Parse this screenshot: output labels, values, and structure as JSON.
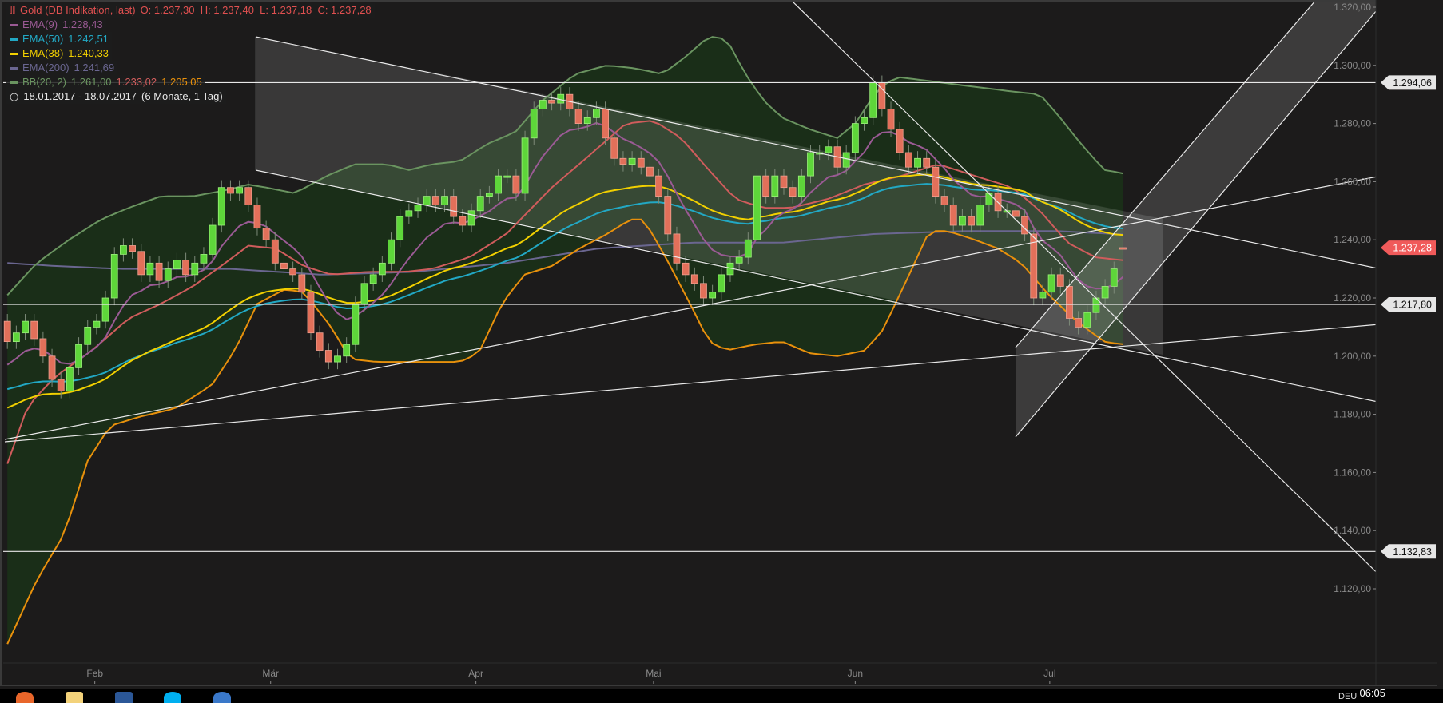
{
  "legend": {
    "title": "Gold (DB Indikation, last)",
    "ohlc": "O: 1.237,30  H: 1.237,40  L: 1.237,18  C: 1.237,28",
    "ema9": {
      "label": "EMA(9)",
      "value": "1.228,43",
      "color": "#9a5a94"
    },
    "ema50": {
      "label": "EMA(50)",
      "value": "1.242,51",
      "color": "#22a8c4"
    },
    "ema38": {
      "label": "EMA(38)",
      "value": "1.240,33",
      "color": "#f2d000"
    },
    "ema200": {
      "label": "EMA(200)",
      "value": "1.241,69",
      "color": "#6a6690"
    },
    "bb": {
      "label": "BB(20, 2)",
      "upper": "1.261,00",
      "mid": "1.233,02",
      "lower": "1.205,05",
      "color_upper": "#6a9460",
      "color_mid": "#d05c5c",
      "color_lower": "#e8900c"
    },
    "range": "18.01.2017 - 18.07.2017",
    "span": "(6 Monate, 1 Tag)"
  },
  "price_tags": [
    {
      "value": 1294.06,
      "label": "1.294,06",
      "color": "#e6e6e6"
    },
    {
      "value": 1237.28,
      "label": "1.237,28",
      "color": "#f05a5a"
    },
    {
      "value": 1217.8,
      "label": "1.217,80",
      "color": "#e6e6e6"
    },
    {
      "value": 1132.83,
      "label": "1.132,83",
      "color": "#e6e6e6"
    }
  ],
  "taskbar": {
    "clock": "06:05",
    "lang": "DEU"
  },
  "chart_data": {
    "type": "candlestick",
    "title": "Gold (DB Indikation, last)",
    "ylim": [
      1100,
      1325
    ],
    "yticks": [
      {
        "v": 1320,
        "l": "1.320,00"
      },
      {
        "v": 1300,
        "l": "1.300,00"
      },
      {
        "v": 1280,
        "l": "1.280,00"
      },
      {
        "v": 1260,
        "l": "1.260,00"
      },
      {
        "v": 1240,
        "l": "1.240,00"
      },
      {
        "v": 1220,
        "l": "1.220,00"
      },
      {
        "v": 1200,
        "l": "1.200,00"
      },
      {
        "v": 1180,
        "l": "1.180,00"
      },
      {
        "v": 1160,
        "l": "1.160,00"
      },
      {
        "v": 1140,
        "l": "1.140,00"
      },
      {
        "v": 1120,
        "l": "1.120,00"
      }
    ],
    "xticks": [
      {
        "bar": 9.8,
        "l": "Feb"
      },
      {
        "bar": 29.5,
        "l": "Mär"
      },
      {
        "bar": 52.5,
        "l": "Apr"
      },
      {
        "bar": 72.4,
        "l": "Mai"
      },
      {
        "bar": 95,
        "l": "Jun"
      },
      {
        "bar": 116.8,
        "l": "Jul"
      }
    ],
    "close": [
      1205,
      1208,
      1212,
      1206,
      1200,
      1192,
      1188,
      1196,
      1204,
      1210,
      1212,
      1220,
      1235,
      1238,
      1236,
      1228,
      1232,
      1226,
      1230,
      1233,
      1228,
      1232,
      1235,
      1245,
      1258,
      1256,
      1258,
      1252,
      1244,
      1240,
      1232,
      1230,
      1228,
      1222,
      1208,
      1202,
      1198,
      1200,
      1204,
      1218,
      1225,
      1228,
      1232,
      1240,
      1248,
      1250,
      1252,
      1255,
      1252,
      1255,
      1248,
      1245,
      1250,
      1255,
      1256,
      1262,
      1262,
      1256,
      1275,
      1285,
      1288,
      1287,
      1290,
      1285,
      1280,
      1282,
      1285,
      1275,
      1268,
      1266,
      1268,
      1265,
      1262,
      1255,
      1242,
      1232,
      1228,
      1225,
      1220,
      1222,
      1228,
      1232,
      1234,
      1240,
      1262,
      1255,
      1262,
      1258,
      1255,
      1262,
      1270,
      1270,
      1272,
      1265,
      1270,
      1280,
      1282,
      1294,
      1285,
      1278,
      1270,
      1265,
      1268,
      1265,
      1255,
      1252,
      1245,
      1248,
      1245,
      1252,
      1256,
      1250,
      1250,
      1248,
      1242,
      1220,
      1222,
      1228,
      1224,
      1213,
      1210,
      1215,
      1220,
      1224,
      1230,
      1237.28
    ],
    "first_open": 1212,
    "ema_start": {
      "ema9": 1195,
      "ema38": 1181,
      "ema50": 1188
    },
    "bb_upper": [
      [
        0,
        1221
      ],
      [
        3.3,
        1232
      ],
      [
        6.9,
        1240
      ],
      [
        10.5,
        1247
      ],
      [
        13.6,
        1251
      ],
      [
        17.2,
        1255
      ],
      [
        20.8,
        1255
      ],
      [
        24.4,
        1257
      ],
      [
        27,
        1259
      ],
      [
        29,
        1258
      ],
      [
        32.2,
        1256
      ],
      [
        35.8,
        1262
      ],
      [
        38.9,
        1266
      ],
      [
        42.5,
        1266
      ],
      [
        45,
        1264
      ],
      [
        47.6,
        1266
      ],
      [
        50.7,
        1267
      ],
      [
        53.8,
        1273
      ],
      [
        56.9,
        1277
      ],
      [
        60,
        1288
      ],
      [
        63.6,
        1297
      ],
      [
        67.2,
        1300
      ],
      [
        70.3,
        1299
      ],
      [
        73.4,
        1297
      ],
      [
        76,
        1303
      ],
      [
        78.6,
        1310
      ],
      [
        80.6,
        1309
      ],
      [
        82.7,
        1297
      ],
      [
        84.7,
        1288
      ],
      [
        86.8,
        1282
      ],
      [
        89.9,
        1278
      ],
      [
        93,
        1275
      ],
      [
        95,
        1280
      ],
      [
        97.6,
        1292
      ],
      [
        99.7,
        1296
      ],
      [
        102.3,
        1295
      ],
      [
        107.4,
        1293
      ],
      [
        112.6,
        1291
      ],
      [
        115.7,
        1290
      ],
      [
        117.7,
        1283
      ],
      [
        120.3,
        1273
      ],
      [
        122.9,
        1264
      ],
      [
        124.9,
        1263
      ],
      [
        126,
        1261
      ]
    ],
    "bb_mid": [
      [
        0,
        1163
      ],
      [
        2.3,
        1183
      ],
      [
        5.4,
        1193
      ],
      [
        9.5,
        1202
      ],
      [
        13.6,
        1213
      ],
      [
        17.2,
        1218
      ],
      [
        20.8,
        1224
      ],
      [
        24.4,
        1232
      ],
      [
        27,
        1238
      ],
      [
        30.1,
        1237
      ],
      [
        33.2,
        1231
      ],
      [
        36.3,
        1228
      ],
      [
        40.4,
        1229
      ],
      [
        44.5,
        1229
      ],
      [
        47.6,
        1230
      ],
      [
        51.8,
        1234
      ],
      [
        55.9,
        1242
      ],
      [
        61,
        1258
      ],
      [
        65.2,
        1269
      ],
      [
        69.3,
        1280
      ],
      [
        72.4,
        1281
      ],
      [
        75.5,
        1275
      ],
      [
        78.6,
        1264
      ],
      [
        81.6,
        1254
      ],
      [
        84.7,
        1251
      ],
      [
        87.8,
        1251
      ],
      [
        91.9,
        1254
      ],
      [
        96,
        1259
      ],
      [
        100.2,
        1262
      ],
      [
        104.3,
        1266
      ],
      [
        108.4,
        1262
      ],
      [
        112.6,
        1258
      ],
      [
        115.7,
        1250
      ],
      [
        118.8,
        1239
      ],
      [
        121.9,
        1234
      ],
      [
        124.9,
        1233
      ],
      [
        126,
        1233.02
      ]
    ],
    "bb_lower": [
      [
        0,
        1101
      ],
      [
        3.3,
        1123
      ],
      [
        6.4,
        1139
      ],
      [
        9,
        1164
      ],
      [
        11.5,
        1176
      ],
      [
        14.6,
        1179
      ],
      [
        18.8,
        1182
      ],
      [
        22.9,
        1190
      ],
      [
        25.5,
        1202
      ],
      [
        28,
        1218
      ],
      [
        31.1,
        1223
      ],
      [
        33.2,
        1222
      ],
      [
        36.3,
        1210
      ],
      [
        38.4,
        1199
      ],
      [
        41.4,
        1198
      ],
      [
        45.6,
        1198
      ],
      [
        50.7,
        1198
      ],
      [
        52.8,
        1201
      ],
      [
        55.4,
        1218
      ],
      [
        57.9,
        1228
      ],
      [
        61,
        1231
      ],
      [
        64.1,
        1237
      ],
      [
        67.2,
        1242
      ],
      [
        69.8,
        1247
      ],
      [
        71.3,
        1247
      ],
      [
        73.4,
        1236
      ],
      [
        76.5,
        1218
      ],
      [
        78.6,
        1205
      ],
      [
        80.6,
        1202
      ],
      [
        83.7,
        1204
      ],
      [
        86.8,
        1205
      ],
      [
        89.9,
        1201
      ],
      [
        93,
        1200
      ],
      [
        96.1,
        1202
      ],
      [
        98.1,
        1209
      ],
      [
        101.2,
        1229
      ],
      [
        103.3,
        1243
      ],
      [
        105.4,
        1243
      ],
      [
        108.4,
        1240
      ],
      [
        111,
        1237
      ],
      [
        113.6,
        1232
      ],
      [
        116.7,
        1221
      ],
      [
        119.8,
        1212
      ],
      [
        122.9,
        1205
      ],
      [
        124.9,
        1204
      ],
      [
        126,
        1205.05
      ]
    ],
    "ema200": [
      [
        0,
        1232
      ],
      [
        5.4,
        1231
      ],
      [
        12.6,
        1230
      ],
      [
        25,
        1230
      ],
      [
        35.3,
        1228
      ],
      [
        45.6,
        1229
      ],
      [
        55.9,
        1232
      ],
      [
        66.2,
        1237
      ],
      [
        76.5,
        1239
      ],
      [
        86.8,
        1239
      ],
      [
        97.1,
        1242
      ],
      [
        107.4,
        1243
      ],
      [
        117.7,
        1243
      ],
      [
        126,
        1241.69
      ]
    ]
  }
}
